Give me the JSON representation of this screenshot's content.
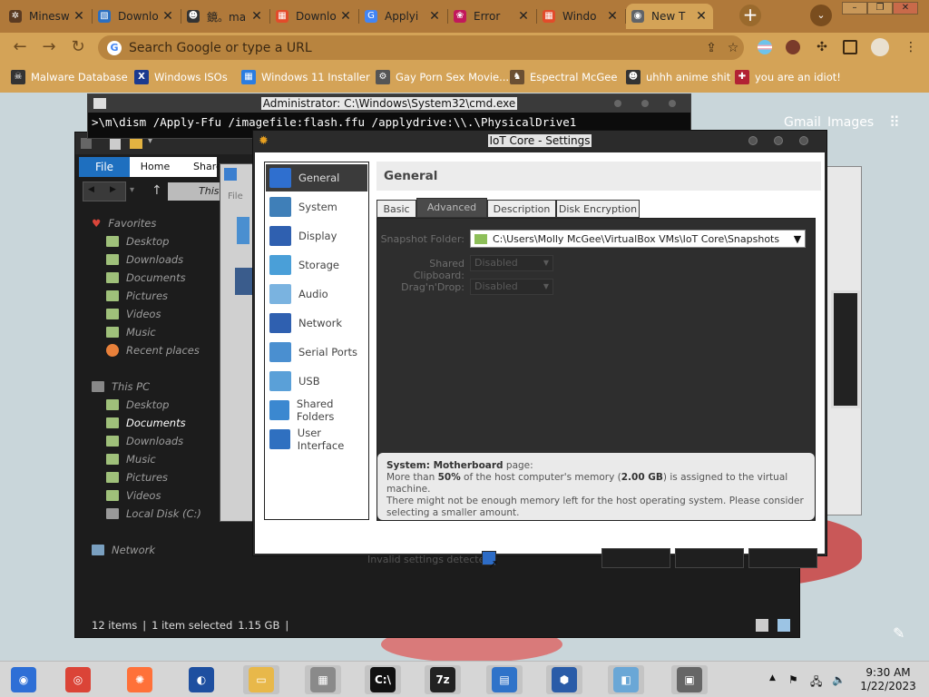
{
  "browser": {
    "tabs": [
      {
        "title": "Minesw",
        "color": "#5a3a22",
        "glyph": "✲"
      },
      {
        "title": "Downlo",
        "color": "#2b6fc1",
        "glyph": "▧"
      },
      {
        "title": "鏡。ma",
        "color": "#333333",
        "glyph": "☻"
      },
      {
        "title": "Downlo",
        "color": "#e24b2a",
        "glyph": "▦"
      },
      {
        "title": "Applyi",
        "color": "#4285f4",
        "glyph": "G"
      },
      {
        "title": "Error",
        "color": "#c2185b",
        "glyph": "❀"
      },
      {
        "title": "Windo",
        "color": "#e24b2a",
        "glyph": "▦"
      },
      {
        "title": "New T",
        "color": "#5f6368",
        "glyph": "◉"
      }
    ],
    "omnibox_placeholder": "Search Google or type a URL",
    "bookmarks": [
      {
        "label": "Malware Database",
        "icon": "skull-icon",
        "color": "#333333",
        "glyph": "☠"
      },
      {
        "label": "Windows ISOs",
        "icon": "x-icon",
        "color": "#1b3a8f",
        "glyph": "X"
      },
      {
        "label": "Windows 11 Installer",
        "icon": "windows-icon",
        "color": "#2b7de1",
        "glyph": "▦"
      },
      {
        "label": "Gay Porn Sex Movie...",
        "icon": "gear-icon",
        "color": "#555555",
        "glyph": "⚙"
      },
      {
        "label": "Espectral McGee",
        "icon": "ghost-icon",
        "color": "#6b4f33",
        "glyph": "♞"
      },
      {
        "label": "uhhh anime shit",
        "icon": "anime-icon",
        "color": "#333333",
        "glyph": "☻"
      },
      {
        "label": "you are an idiot!",
        "icon": "flag-icon",
        "color": "#b22234",
        "glyph": "✚"
      }
    ],
    "gmail": "Gmail",
    "images": "Images"
  },
  "cmd": {
    "title": "Administrator: C:\\Windows\\System32\\cmd.exe",
    "line": ">\\m\\dism /Apply-Ffu /imagefile:flash.ffu /applydrive:\\\\.\\PhysicalDrive1"
  },
  "explorer": {
    "ribbon_tabs": {
      "file": "File",
      "home": "Home",
      "share": "Share"
    },
    "addr_fragment": "This",
    "partial_file_menu": "File",
    "favorites_header": "Favorites",
    "favorites": [
      "Desktop",
      "Downloads",
      "Documents",
      "Pictures",
      "Videos",
      "Music",
      "Recent places"
    ],
    "thispc_header": "This PC",
    "thispc": [
      "Desktop",
      "Documents",
      "Downloads",
      "Music",
      "Pictures",
      "Videos",
      "Local Disk (C:)"
    ],
    "selected": "Documents",
    "network": "Network",
    "status": {
      "items": "12 items",
      "selected": "1 item selected",
      "size": "1.15 GB"
    }
  },
  "settings": {
    "title": "IoT Core - Settings",
    "nav": [
      {
        "label": "General",
        "color": "#2f6fcf"
      },
      {
        "label": "System",
        "color": "#3f7fb8"
      },
      {
        "label": "Display",
        "color": "#2f60b0"
      },
      {
        "label": "Storage",
        "color": "#4a9fd8"
      },
      {
        "label": "Audio",
        "color": "#7ab3e0"
      },
      {
        "label": "Network",
        "color": "#2f60b0"
      },
      {
        "label": "Serial Ports",
        "color": "#4a8fd0"
      },
      {
        "label": "USB",
        "color": "#5aa0d8"
      },
      {
        "label": "Shared Folders",
        "color": "#3b88d0"
      },
      {
        "label": "User Interface",
        "color": "#2f70c0"
      }
    ],
    "selected_nav": "General",
    "page_title": "General",
    "tabs": [
      "Basic",
      "Advanced",
      "Description",
      "Disk Encryption"
    ],
    "active_tab": "Advanced",
    "fields": {
      "snapshot_label": "Snapshot Folder:",
      "snapshot_value": "C:\\Users\\Molly McGee\\VirtualBox VMs\\IoT Core\\Snapshots",
      "clipboard_label": "Shared Clipboard:",
      "clipboard_value": "Disabled",
      "dragdrop_label": "Drag'n'Drop:",
      "dragdrop_value": "Disabled"
    },
    "warning": {
      "heading": "System: Motherboard",
      "heading_suffix": " page:",
      "line1_pre": "More than ",
      "line1_pct": "50%",
      "line1_mid": " of the host computer's memory (",
      "line1_mem": "2.00 GB",
      "line1_post": ") is assigned to the virtual machine.",
      "line2": "There might not be enough memory left for the host operating system. Please consider",
      "line3": "selecting a smaller amount."
    },
    "invalid_text": "Invalid settings detected"
  },
  "taskbar": {
    "apps": [
      {
        "name": "start-button",
        "color": "#2e6fd6",
        "glyph": "◉"
      },
      {
        "name": "chrome-taskbar-icon",
        "color": "#db4437",
        "glyph": "◎"
      },
      {
        "name": "firefox-taskbar-icon",
        "color": "#ff7139",
        "glyph": "✺"
      },
      {
        "name": "obama-taskbar-icon",
        "color": "#1e4fa0",
        "glyph": "◐"
      },
      {
        "name": "file-explorer-taskbar-icon",
        "color": "#e8b84a",
        "glyph": "▭"
      },
      {
        "name": "package-taskbar-icon",
        "color": "#8a8a8a",
        "glyph": "▦"
      },
      {
        "name": "cmd-taskbar-icon",
        "color": "#111111",
        "glyph": "C:\\"
      },
      {
        "name": "7zip-taskbar-icon",
        "color": "#222222",
        "glyph": "7z"
      },
      {
        "name": "settings-app-taskbar-icon",
        "color": "#2f73c9",
        "glyph": "▤"
      },
      {
        "name": "virtualbox-taskbar-icon",
        "color": "#2a5ca8",
        "glyph": "⬢"
      },
      {
        "name": "notepad-taskbar-icon",
        "color": "#6aa7d6",
        "glyph": "◧"
      },
      {
        "name": "installer-taskbar-icon",
        "color": "#666666",
        "glyph": "▣"
      }
    ],
    "time": "9:30 AM",
    "date": "1/22/2023"
  }
}
